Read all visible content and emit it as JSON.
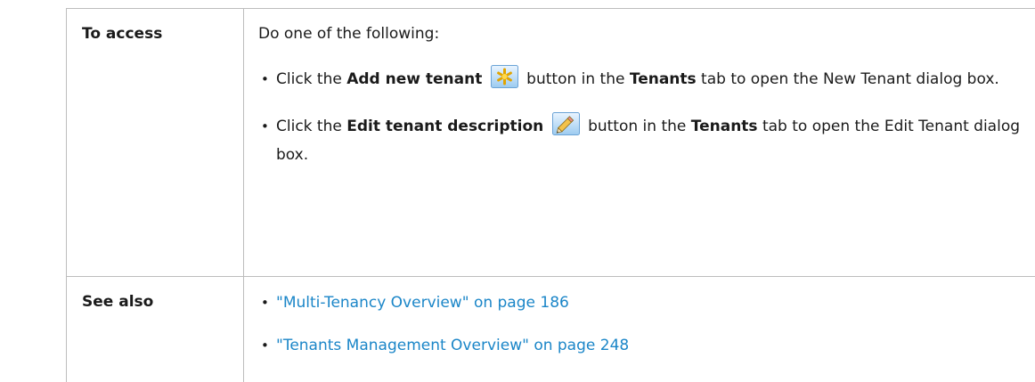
{
  "rows": [
    {
      "label": "To access",
      "intro": "Do one of the following:",
      "items": [
        {
          "before": "Click the ",
          "bold": "Add new tenant",
          "icon": "asterisk-icon",
          "middle": " button in the ",
          "tab": "Tenants",
          "after": " tab to open the New Tenant dialog box."
        },
        {
          "before": "Click the ",
          "bold": "Edit tenant description",
          "icon": "pencil-icon",
          "middle": " button in the ",
          "tab": "Tenants",
          "after": " tab to open the Edit Tenant dialog box."
        }
      ]
    },
    {
      "label": "See also",
      "links": [
        {
          "text": "\"Multi-Tenancy Overview\" on page 186"
        },
        {
          "text": "\"Tenants Management Overview\" on page 248"
        }
      ]
    }
  ],
  "colors": {
    "link": "#1b86c8",
    "border": "#bdbdbd",
    "text": "#1a1a1a"
  }
}
